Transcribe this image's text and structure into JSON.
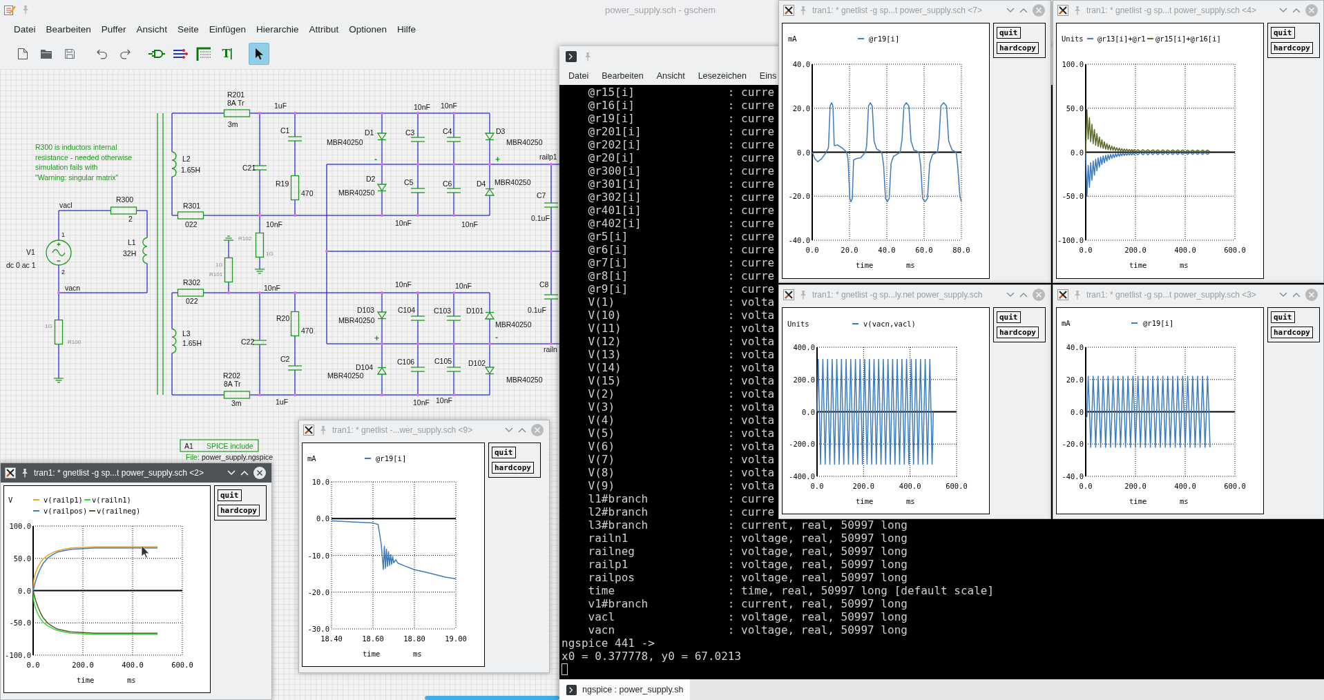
{
  "gschem": {
    "title": "power_supply.sch - gschem",
    "menu": [
      "Datei",
      "Bearbeiten",
      "Puffer",
      "Ansicht",
      "Seite",
      "Einfügen",
      "Hierarchie",
      "Attribut",
      "Optionen",
      "Hilfe"
    ],
    "actions": [
      {
        "kind": "new"
      },
      {
        "kind": "open"
      },
      {
        "kind": "save"
      },
      {
        "kind": "undo"
      },
      {
        "kind": "redo"
      }
    ],
    "modes": [
      {
        "kind": "component",
        "selected": false
      },
      {
        "kind": "net",
        "selected": false
      },
      {
        "kind": "attribute",
        "selected": false
      },
      {
        "kind": "text",
        "glyph": "T",
        "selected": false
      },
      {
        "kind": "select",
        "selected": true
      }
    ],
    "schematic": {
      "note": [
        "R300 is inductors internal",
        "resistance - needed otherwise",
        "simulation fails with",
        "\"Warning: singular matrix\""
      ],
      "components": [
        {
          "kind": "resistor",
          "ref": "R201",
          "value": "3m",
          "rating": "8A Tr"
        },
        {
          "kind": "inductor",
          "ref": "L2",
          "value": "1.65H"
        },
        {
          "kind": "resistor",
          "ref": "R301",
          "value": "022"
        },
        {
          "kind": "capacitor",
          "ref": "C21",
          "value": "10nF"
        },
        {
          "kind": "capacitor",
          "ref": "C1",
          "value": "1uF"
        },
        {
          "kind": "resistor",
          "ref": "R19",
          "value": "470"
        },
        {
          "kind": "diode",
          "ref": "D1",
          "value": "MBR40250"
        },
        {
          "kind": "diode",
          "ref": "D2",
          "value": "MBR40250"
        },
        {
          "kind": "capacitor",
          "ref": "C3",
          "value": "10nF"
        },
        {
          "kind": "capacitor",
          "ref": "C5",
          "value": "10nF"
        },
        {
          "kind": "capacitor",
          "ref": "C4",
          "value": "10nF"
        },
        {
          "kind": "capacitor",
          "ref": "C6",
          "value": "10nF"
        },
        {
          "kind": "diode",
          "ref": "D3",
          "value": "MBR40250"
        },
        {
          "kind": "diode",
          "ref": "D4",
          "value": "MBR40250"
        },
        {
          "kind": "capacitor",
          "ref": "C7",
          "value": "0.1uF"
        },
        {
          "kind": "source",
          "ref": "V1",
          "value": "dc 0 ac 1",
          "pins": [
            "1",
            "2"
          ]
        },
        {
          "kind": "resistor",
          "ref": "R300",
          "value": "2"
        },
        {
          "kind": "inductor",
          "ref": "L1",
          "value": "32H"
        },
        {
          "kind": "resistor",
          "ref": "R100",
          "value": "1G"
        },
        {
          "kind": "resistor",
          "ref": "R101",
          "value": "1G"
        },
        {
          "kind": "resistor",
          "ref": "R102",
          "value": "1G"
        },
        {
          "kind": "resistor",
          "ref": "R302",
          "value": "022"
        },
        {
          "kind": "inductor",
          "ref": "L3",
          "value": "1.65H"
        },
        {
          "kind": "capacitor",
          "ref": "C22",
          "value": "10nF"
        },
        {
          "kind": "resistor",
          "ref": "R20",
          "value": "470"
        },
        {
          "kind": "resistor",
          "ref": "R202",
          "value": "3m",
          "rating": "8A Tr"
        },
        {
          "kind": "capacitor",
          "ref": "C2",
          "value": "1uF"
        },
        {
          "kind": "diode",
          "ref": "D103",
          "value": "MBR40250"
        },
        {
          "kind": "diode",
          "ref": "D104",
          "value": "MBR40250"
        },
        {
          "kind": "capacitor",
          "ref": "C104",
          "value": "10nF"
        },
        {
          "kind": "capacitor",
          "ref": "C106",
          "value": "10nF"
        },
        {
          "kind": "capacitor",
          "ref": "C103",
          "value": "10nF"
        },
        {
          "kind": "capacitor",
          "ref": "C105",
          "value": "10nF"
        },
        {
          "kind": "diode",
          "ref": "D101",
          "value": "MBR40250"
        },
        {
          "kind": "diode",
          "ref": "D102",
          "value": "MBR40250"
        },
        {
          "kind": "capacitor",
          "ref": "C8",
          "value": "0.1uF"
        }
      ],
      "net_labels": [
        "vacl",
        "vacn",
        "railp1",
        "railn"
      ],
      "polarity_marks": [
        "-",
        "+",
        "+",
        "-"
      ],
      "spice_include": {
        "ref": "A1",
        "label": "SPICE include",
        "file_label": "File:",
        "file": "power_supply.ngspice"
      }
    }
  },
  "terminal": {
    "menu": [
      "Datei",
      "Bearbeiten",
      "Ansicht",
      "Lesezeichen",
      "Eins"
    ],
    "lines": [
      {
        "name": "@r15[i]",
        "info": ": curre"
      },
      {
        "name": "@r16[i]",
        "info": ": curre"
      },
      {
        "name": "@r19[i]",
        "info": ": curre"
      },
      {
        "name": "@r201[i]",
        "info": ": curre"
      },
      {
        "name": "@r202[i]",
        "info": ": curre"
      },
      {
        "name": "@r20[i]",
        "info": ": curre"
      },
      {
        "name": "@r300[i]",
        "info": ": curre"
      },
      {
        "name": "@r301[i]",
        "info": ": curre"
      },
      {
        "name": "@r302[i]",
        "info": ": curre"
      },
      {
        "name": "@r401[i]",
        "info": ": curre"
      },
      {
        "name": "@r402[i]",
        "info": ": curre"
      },
      {
        "name": "@r5[i]",
        "info": ": curre"
      },
      {
        "name": "@r6[i]",
        "info": ": curre"
      },
      {
        "name": "@r7[i]",
        "info": ": curre"
      },
      {
        "name": "@r8[i]",
        "info": ": curre"
      },
      {
        "name": "@r9[i]",
        "info": ": curre"
      },
      {
        "name": "V(1)",
        "info": ": volta"
      },
      {
        "name": "V(10)",
        "info": ": volta"
      },
      {
        "name": "V(11)",
        "info": ": volta"
      },
      {
        "name": "V(12)",
        "info": ": volta"
      },
      {
        "name": "V(13)",
        "info": ": volta"
      },
      {
        "name": "V(14)",
        "info": ": volta"
      },
      {
        "name": "V(15)",
        "info": ": volta"
      },
      {
        "name": "V(2)",
        "info": ": volta"
      },
      {
        "name": "V(3)",
        "info": ": volta"
      },
      {
        "name": "V(4)",
        "info": ": volta"
      },
      {
        "name": "V(5)",
        "info": ": volta"
      },
      {
        "name": "V(6)",
        "info": ": volta"
      },
      {
        "name": "V(7)",
        "info": ": volta"
      },
      {
        "name": "V(8)",
        "info": ": volta"
      },
      {
        "name": "V(9)",
        "info": ": volta"
      },
      {
        "name": "l1#branch",
        "info": ": curre"
      },
      {
        "name": "l2#branch",
        "info": ": curre"
      },
      {
        "name": "l3#branch",
        "info": ": current, real, 50997 long"
      },
      {
        "name": "railn1",
        "info": ": voltage, real, 50997 long"
      },
      {
        "name": "railneg",
        "info": ": voltage, real, 50997 long"
      },
      {
        "name": "railp1",
        "info": ": voltage, real, 50997 long"
      },
      {
        "name": "railpos",
        "info": ": voltage, real, 50997 long"
      },
      {
        "name": "time",
        "info": ": time, real, 50997 long [default scale]"
      },
      {
        "name": "v1#branch",
        "info": ": current, real, 50997 long"
      },
      {
        "name": "vacl",
        "info": ": voltage, real, 50997 long"
      },
      {
        "name": "vacn",
        "info": ": voltage, real, 50997 long"
      }
    ],
    "prompt": "ngspice 441 ->",
    "output": "x0 = 0.377778, y0 = 67.0213",
    "tab": "ngspice : power_supply.sh"
  },
  "plot_windows": [
    {
      "title": "tran1: * gnetlist -g sp...t power_supply.sch <7>",
      "active": false,
      "buttons": [
        "quit",
        "hardcopy"
      ],
      "chart_data": {
        "type": "line",
        "ylabel": "mA",
        "xlabel": "time",
        "annotations": [
          {
            "text": "ms"
          }
        ],
        "grid": true,
        "legend": "upper center",
        "x": [
          0,
          1.5,
          3,
          5,
          7.5,
          8.7,
          9.6,
          10.4,
          11.1,
          11.8,
          13.5,
          16,
          18.5,
          19.2,
          20.2,
          20.8,
          21.5,
          22.2,
          24,
          26,
          28.5,
          29.2,
          30.2,
          31.2,
          32.2,
          33.2,
          34.5,
          37.3,
          38.3,
          39.3,
          40.3,
          41.3,
          42.3,
          43.5,
          47.2,
          48.2,
          49.2,
          50.5,
          51.8,
          53,
          54.5,
          57.2,
          58.2,
          59.2,
          60.5,
          61.8,
          63,
          64.5,
          67.2,
          68,
          69,
          70.5,
          72,
          73.2,
          75,
          77.2,
          78,
          79.2,
          80
        ],
        "series": [
          {
            "name": "@r19[i]",
            "color": "#3b7bbf",
            "values": [
              0,
              -3,
              -4.3,
              -3,
              0,
              2,
              21,
              22.5,
              21,
              3,
              3.3,
              2,
              0,
              -3,
              -21,
              -22.5,
              -21,
              -3.5,
              -2.8,
              -2.5,
              0,
              3,
              21,
              22.5,
              21,
              5,
              1.5,
              0,
              -6,
              -21,
              -22.5,
              -21,
              -5,
              -2,
              0,
              6,
              21,
              22.5,
              21,
              5,
              1,
              0,
              -6,
              -21,
              -22.5,
              -21,
              -5,
              -1,
              0,
              6,
              21,
              22.5,
              21,
              5,
              1,
              0,
              -6,
              -20,
              -22.5
            ]
          }
        ],
        "xlim": [
          0,
          80
        ],
        "ylim": [
          -40,
          40
        ],
        "xticks": [
          {
            "value": 0,
            "label": "0.0"
          },
          {
            "value": 20,
            "label": "20.0"
          },
          {
            "value": 40,
            "label": "40.0"
          },
          {
            "value": 60,
            "label": "60.0"
          },
          {
            "value": 80,
            "label": "80.0"
          }
        ],
        "yticks": [
          {
            "value": -40,
            "label": "-40.0"
          },
          {
            "value": -20,
            "label": "-20.0"
          },
          {
            "value": 0,
            "label": "0.0"
          },
          {
            "value": 20,
            "label": "20.0"
          },
          {
            "value": 40,
            "label": "40.0"
          }
        ]
      }
    },
    {
      "title": "tran1: * gnetlist -g sp...t power_supply.sch <4>",
      "active": false,
      "buttons": [
        "quit",
        "hardcopy"
      ],
      "chart_data": {
        "type": "line",
        "ylabel": "Units",
        "xlabel": "time",
        "annotations": [
          {
            "text": "ms"
          }
        ],
        "grid": true,
        "legend": "upper left",
        "x": [
          0,
          5,
          10,
          15,
          20,
          25,
          30,
          35,
          40,
          45,
          50,
          55,
          60,
          65,
          70,
          75,
          80,
          85,
          90,
          95,
          100,
          105,
          110,
          115,
          120,
          125,
          130,
          135,
          140,
          145,
          150,
          155,
          160,
          165,
          170,
          175,
          180,
          185,
          190,
          195,
          200,
          210,
          220,
          230,
          240,
          250,
          260,
          270,
          280,
          290,
          300,
          310,
          320,
          330,
          340,
          350,
          360,
          370,
          380,
          390,
          400,
          410,
          420,
          430,
          440,
          450,
          460,
          470,
          480,
          490,
          500
        ],
        "series": [
          {
            "name": "@r13[i]+@r1",
            "color": "#3b7bbf",
            "values": [
              0,
              -50,
              -15,
              -40,
              -12,
              -32,
              -10,
              -26,
              -8,
              -21,
              -6.5,
              -17,
              -5.3,
              -14,
              -4.3,
              -12,
              -3.5,
              -10,
              -3,
              -8.3,
              -2.4,
              -7,
              -2.1,
              -6.1,
              -1.7,
              -5.2,
              -1.5,
              -4.6,
              -1.3,
              -4.1,
              -1.1,
              -3.7,
              -1,
              -3.5,
              -0.9,
              -3.3,
              -0.8,
              -3.1,
              -0.7,
              -3,
              -0.7,
              -2.9,
              -0.4,
              -2.8,
              -0.4,
              -2.8,
              -0.4,
              -2.7,
              -0.4,
              -2.7,
              -0.4,
              -2.7,
              -0.4,
              -2.6,
              -0.4,
              -2.6,
              -0.4,
              -2.6,
              -0.4,
              -2.6,
              -0.4,
              -2.5,
              -0.4,
              -2.5,
              -0.4,
              -2.5,
              -0.4,
              -2.5,
              -0.4,
              -2.5,
              -0.4
            ]
          },
          {
            "name": "@r15[i]+@r16[i]",
            "color": "#5b6b2a",
            "values": [
              0,
              48.5,
              14.9,
              39.3,
              12,
              31.8,
              9.7,
              25.9,
              7.9,
              21.1,
              6.4,
              17.3,
              5.3,
              14.3,
              4.3,
              11.8,
              3.5,
              9.9,
              2.9,
              8.3,
              2.4,
              7,
              2.1,
              6.1,
              1.7,
              5.2,
              1.5,
              4.6,
              1.3,
              4.1,
              1.1,
              3.7,
              1,
              3.5,
              0.9,
              3.3,
              0.8,
              3.1,
              0.7,
              3,
              0.7,
              2.9,
              0.6,
              2.8,
              0.6,
              2.8,
              0.6,
              2.7,
              0.6,
              2.7,
              0.5,
              2.7,
              0.5,
              2.6,
              0.5,
              2.6,
              0.5,
              2.6,
              0.5,
              2.6,
              0.5,
              2.5,
              0.5,
              2.5,
              0.5,
              2.5,
              0.5,
              2.5,
              0.5,
              2.5,
              0.5
            ]
          }
        ],
        "xlim": [
          0,
          600
        ],
        "ylim": [
          -100,
          100
        ],
        "xticks": [
          {
            "value": 0,
            "label": "0.0"
          },
          {
            "value": 200,
            "label": "200.0"
          },
          {
            "value": 400,
            "label": "400.0"
          },
          {
            "value": 600,
            "label": "600.0"
          }
        ],
        "yticks": [
          {
            "value": -100,
            "label": "-100.0"
          },
          {
            "value": -50,
            "label": "-50.0"
          },
          {
            "value": 0,
            "label": "0.0"
          },
          {
            "value": 50,
            "label": "50.0"
          },
          {
            "value": 100,
            "label": "100.0"
          }
        ]
      }
    },
    {
      "title": "tran1: * gnetlist -g sp...ly.net power_supply.sch",
      "active": false,
      "buttons": [
        "quit",
        "hardcopy"
      ],
      "chart_data": {
        "type": "line",
        "ylabel": "Units",
        "xlabel": "time",
        "annotations": [
          {
            "text": "ms"
          }
        ],
        "grid": true,
        "legend": "upper center",
        "x": [
          0,
          5,
          10,
          15,
          20,
          25,
          30,
          35,
          40,
          45,
          50,
          55,
          60,
          65,
          70,
          75,
          80,
          85,
          90,
          95,
          100,
          105,
          110,
          115,
          120,
          125,
          130,
          135,
          140,
          145,
          150,
          155,
          160,
          165,
          170,
          175,
          180,
          185,
          190,
          195,
          200,
          205,
          210,
          215,
          220,
          225,
          230,
          235,
          240,
          245,
          250,
          255,
          260,
          265,
          270,
          275,
          280,
          285,
          290,
          295,
          300,
          305,
          310,
          315,
          320,
          325,
          330,
          335,
          340,
          345,
          350,
          355,
          360,
          365,
          370,
          375,
          380,
          385,
          390,
          395,
          400,
          405,
          410,
          415,
          420,
          425,
          430,
          435,
          440,
          445,
          450,
          455,
          460,
          465,
          470,
          475,
          480,
          485,
          490,
          495,
          500
        ],
        "series": [
          {
            "name": "v(vacn,vacl)",
            "color": "#3b7bbf",
            "values": [
              0,
              325,
              0,
              -325,
              0,
              325,
              0,
              -325,
              0,
              325,
              0,
              -325,
              0,
              325,
              0,
              -325,
              0,
              325,
              0,
              -325,
              0,
              325,
              0,
              -325,
              0,
              325,
              0,
              -325,
              0,
              325,
              0,
              -325,
              0,
              325,
              0,
              -325,
              0,
              325,
              0,
              -325,
              0,
              325,
              0,
              -325,
              0,
              325,
              0,
              -325,
              0,
              325,
              0,
              -325,
              0,
              325,
              0,
              -325,
              0,
              325,
              0,
              -325,
              0,
              325,
              0,
              -325,
              0,
              325,
              0,
              -325,
              0,
              325,
              0,
              -325,
              0,
              325,
              0,
              -325,
              0,
              325,
              0,
              -325,
              0,
              325,
              0,
              -325,
              0,
              325,
              0,
              -325,
              0,
              325,
              0,
              -325,
              0,
              325,
              0,
              -325,
              0,
              325,
              0,
              -325,
              0
            ]
          }
        ],
        "xlim": [
          0,
          600
        ],
        "ylim": [
          -400,
          400
        ],
        "xticks": [
          {
            "value": 0,
            "label": "0.0"
          },
          {
            "value": 200,
            "label": "200.0"
          },
          {
            "value": 400,
            "label": "400.0"
          },
          {
            "value": 600,
            "label": "600.0"
          }
        ],
        "yticks": [
          {
            "value": -400,
            "label": "-400.0"
          },
          {
            "value": -200,
            "label": "-200.0"
          },
          {
            "value": 0,
            "label": "0.0"
          },
          {
            "value": 200,
            "label": "200.0"
          },
          {
            "value": 400,
            "label": "400.0"
          }
        ]
      }
    },
    {
      "title": "tran1: * gnetlist -g sp...t power_supply.sch <3>",
      "active": false,
      "buttons": [
        "quit",
        "hardcopy"
      ],
      "chart_data": {
        "type": "line",
        "ylabel": "mA",
        "xlabel": "time",
        "annotations": [
          {
            "text": "ms"
          }
        ],
        "grid": true,
        "legend": "upper center",
        "x": [
          0,
          5,
          10,
          15,
          20,
          25,
          30,
          35,
          40,
          45,
          50,
          55,
          60,
          65,
          70,
          75,
          80,
          85,
          90,
          95,
          100,
          105,
          110,
          115,
          120,
          125,
          130,
          135,
          140,
          145,
          150,
          155,
          160,
          165,
          170,
          175,
          180,
          185,
          190,
          195,
          200,
          205,
          210,
          215,
          220,
          225,
          230,
          235,
          240,
          245,
          250,
          255,
          260,
          265,
          270,
          275,
          280,
          285,
          290,
          295,
          300,
          305,
          310,
          315,
          320,
          325,
          330,
          335,
          340,
          345,
          350,
          355,
          360,
          365,
          370,
          375,
          380,
          385,
          390,
          395,
          400,
          405,
          410,
          415,
          420,
          425,
          430,
          435,
          440,
          445,
          450,
          455,
          460,
          465,
          470,
          475,
          480,
          485,
          490,
          495,
          500
        ],
        "series": [
          {
            "name": "@r19[i]",
            "color": "#3b7bbf",
            "values": [
              -4,
              -3,
              22,
              2,
              -22,
              -2,
              22,
              2,
              -22,
              -2,
              22,
              2,
              -22,
              -2,
              22,
              2,
              -22,
              -2,
              22,
              2,
              -22,
              -2,
              22,
              2,
              -22,
              -2,
              22,
              2,
              -22,
              -2,
              22,
              2,
              -22,
              -2,
              22,
              2,
              -22,
              -2,
              22,
              2,
              -22,
              -2,
              22,
              2,
              -22,
              -2,
              22,
              2,
              -22,
              -2,
              22,
              2,
              -22,
              -2,
              22,
              2,
              -22,
              -2,
              22,
              2,
              -22,
              -2,
              22,
              2,
              -22,
              -2,
              22,
              2,
              -22,
              -2,
              22,
              2,
              -22,
              -2,
              22,
              2,
              -22,
              -2,
              22,
              2,
              -22,
              -2,
              22,
              2,
              -22,
              -2,
              22,
              2,
              -22,
              -2,
              22,
              2,
              -22,
              -2,
              22,
              2,
              -22,
              -2,
              22,
              2,
              -22
            ]
          }
        ],
        "xlim": [
          0,
          600
        ],
        "ylim": [
          -40,
          40
        ],
        "xticks": [
          {
            "value": 0,
            "label": "0.0"
          },
          {
            "value": 200,
            "label": "200.0"
          },
          {
            "value": 400,
            "label": "400.0"
          },
          {
            "value": 600,
            "label": "600.0"
          }
        ],
        "yticks": [
          {
            "value": -40,
            "label": "-40.0"
          },
          {
            "value": -20,
            "label": "-20.0"
          },
          {
            "value": 0,
            "label": "0.0"
          },
          {
            "value": 20,
            "label": "20.0"
          },
          {
            "value": 40,
            "label": "40.0"
          }
        ]
      }
    },
    {
      "title": "tran1: * gnetlist -...wer_supply.sch <9>",
      "active": false,
      "buttons": [
        "quit",
        "hardcopy"
      ],
      "chart_data": {
        "type": "line",
        "ylabel": "mA",
        "xlabel": "time",
        "annotations": [
          {
            "text": "ms"
          }
        ],
        "grid": true,
        "legend": "upper center",
        "x": [
          18.4,
          18.5,
          18.6,
          18.625,
          18.64,
          18.65,
          18.655,
          18.66,
          18.665,
          18.67,
          18.675,
          18.68,
          18.685,
          18.69,
          18.695,
          18.7,
          18.71,
          18.72,
          18.75,
          18.8,
          18.85,
          18.9,
          18.95,
          19.0
        ],
        "series": [
          {
            "name": "@r19[i]",
            "color": "#3b7bbf",
            "values": [
              -0.6,
              -0.9,
              -1.2,
              -1.6,
              -7,
              -13.8,
              -7.5,
              -13.5,
              -8.3,
              -13,
              -9,
              -12.7,
              -9.8,
              -12.4,
              -10.3,
              -12,
              -11.2,
              -12.1,
              -12.8,
              -13.9,
              -14.5,
              -15.2,
              -15.9,
              -16.4
            ]
          }
        ],
        "xlim": [
          18.4,
          19.0
        ],
        "ylim": [
          -30,
          10
        ],
        "xticks": [
          {
            "value": 18.4,
            "label": "18.40"
          },
          {
            "value": 18.6,
            "label": "18.60"
          },
          {
            "value": 18.8,
            "label": "18.80"
          },
          {
            "value": 19.0,
            "label": "19.00"
          }
        ],
        "yticks": [
          {
            "value": -30,
            "label": "-30.0"
          },
          {
            "value": -20,
            "label": "-20.0"
          },
          {
            "value": -10,
            "label": "-10.0"
          },
          {
            "value": 0,
            "label": "0.0"
          },
          {
            "value": 10,
            "label": "10.0"
          }
        ]
      }
    },
    {
      "title": "tran1: * gnetlist -g sp...t power_supply.sch <2>",
      "active": true,
      "buttons": [
        "quit",
        "hardcopy"
      ],
      "chart_data": {
        "type": "line",
        "ylabel": "V",
        "xlabel": "time",
        "annotations": [
          {
            "text": "ms"
          }
        ],
        "grid": true,
        "legend": "upper left",
        "x": [
          0,
          2,
          5,
          10,
          20,
          30,
          40,
          60,
          80,
          100,
          150,
          200,
          250,
          300,
          400,
          500
        ],
        "series": [
          {
            "name": "v(railp1)",
            "color": "#f5a01e",
            "values": [
              0,
              15,
              22,
              28,
              37,
              44,
              49,
              55,
              59,
              62,
              66,
              67,
              68,
              68,
              68,
              68
            ]
          },
          {
            "name": "v(railn1)",
            "color": "#2fdc2f",
            "values": [
              0,
              -15,
              -22,
              -28,
              -37,
              -44,
              -49,
              -55,
              -59,
              -62,
              -66,
              -67,
              -68,
              -68,
              -68,
              -68
            ]
          },
          {
            "name": "v(railpos)",
            "color": "#3b7bbf",
            "values": [
              0,
              3,
              8,
              15,
              26,
              35,
              42,
              51,
              56,
              60,
              64,
              65,
              66,
              66,
              66,
              66
            ]
          },
          {
            "name": "v(railneg)",
            "color": "#5a5a2c",
            "values": [
              0,
              -3,
              -8,
              -15,
              -26,
              -35,
              -42,
              -51,
              -56,
              -60,
              -64,
              -65,
              -66,
              -66,
              -66,
              -66
            ]
          }
        ],
        "xlim": [
          0,
          600
        ],
        "ylim": [
          -100,
          100
        ],
        "xticks": [
          {
            "value": 0,
            "label": "0.0"
          },
          {
            "value": 200,
            "label": "200.0"
          },
          {
            "value": 400,
            "label": "400.0"
          },
          {
            "value": 600,
            "label": "600.0"
          }
        ],
        "yticks": [
          {
            "value": -100,
            "label": "-100.0"
          },
          {
            "value": -50,
            "label": "-50.0"
          },
          {
            "value": 0,
            "label": "0.0"
          },
          {
            "value": 50,
            "label": "50.0"
          },
          {
            "value": 100,
            "label": "100.0"
          }
        ]
      }
    }
  ]
}
